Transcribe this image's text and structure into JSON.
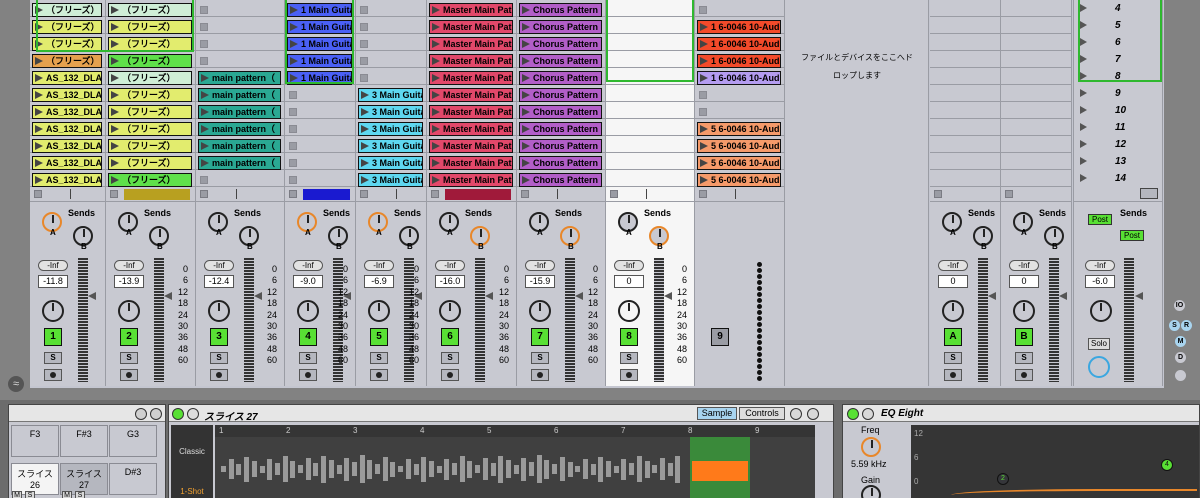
{
  "tracks": [
    {
      "id": "t1",
      "clips": [
        {
          "t": "（フリーズ）",
          "c": "#cfeed6"
        },
        {
          "t": "（フリーズ）",
          "c": "#e2ec6e"
        },
        {
          "t": "（フリーズ）",
          "c": "#e2ec6e"
        },
        {
          "t": "（フリーズ）",
          "c": "#e5a14e"
        },
        {
          "t": "AS_132_DLA",
          "c": "#e2ec6e"
        },
        {
          "t": "AS_132_DLA",
          "c": "#e2ec6e"
        },
        {
          "t": "AS_132_DLA",
          "c": "#e2ec6e"
        },
        {
          "t": "AS_132_DLA",
          "c": "#e2ec6e"
        },
        {
          "t": "AS_132_DLA",
          "c": "#e2ec6e"
        },
        {
          "t": "AS_132_DLA",
          "c": "#e2ec6e"
        },
        {
          "t": "AS_132_DLA",
          "c": "#e2ec6e"
        },
        {
          "t": "AS_132_DLA",
          "c": "#e2ec6e"
        }
      ]
    },
    {
      "id": "t2",
      "clips": [
        {
          "t": "（フリーズ）",
          "c": "#cfeed6"
        },
        {
          "t": "（フリーズ）",
          "c": "#e2ec6e"
        },
        {
          "t": "（フリーズ）",
          "c": "#e2ec6e"
        },
        {
          "t": "（フリーズ）",
          "c": "#5fe04a"
        },
        {
          "t": "（フリーズ）",
          "c": "#cfeed6"
        },
        {
          "t": "（フリーズ）",
          "c": "#e2ec6e"
        },
        {
          "t": "（フリーズ）",
          "c": "#e2ec6e"
        },
        {
          "t": "（フリーズ）",
          "c": "#e2ec6e"
        },
        {
          "t": "（フリーズ）",
          "c": "#e2ec6e"
        },
        {
          "t": "（フリーズ）",
          "c": "#e2ec6e"
        },
        {
          "t": "（フリーズ）",
          "c": "#5fe04a"
        },
        {
          "t": "",
          "c": ""
        }
      ]
    },
    {
      "id": "t3",
      "clips": [
        {
          "t": "",
          "c": ""
        },
        {
          "t": "",
          "c": ""
        },
        {
          "t": "",
          "c": ""
        },
        {
          "t": "",
          "c": ""
        },
        {
          "t": "main pattern（",
          "c": "#2aa893"
        },
        {
          "t": "main pattern（",
          "c": "#2aa893"
        },
        {
          "t": "main pattern（",
          "c": "#2aa893"
        },
        {
          "t": "main pattern（",
          "c": "#2aa893"
        },
        {
          "t": "main pattern（",
          "c": "#2aa893"
        },
        {
          "t": "main pattern（",
          "c": "#2aa893"
        },
        {
          "t": "",
          "c": ""
        },
        {
          "t": "",
          "c": ""
        }
      ]
    },
    {
      "id": "t4",
      "clips": [
        {
          "t": "1 Main Guita",
          "c": "#4a60f5"
        },
        {
          "t": "1 Main Guita",
          "c": "#4a60f5"
        },
        {
          "t": "1 Main Guita",
          "c": "#4a60f5"
        },
        {
          "t": "1 Main Guita",
          "c": "#4a60f5"
        },
        {
          "t": "1 Main Guita",
          "c": "#4a60f5"
        },
        {
          "t": "",
          "c": ""
        },
        {
          "t": "",
          "c": ""
        },
        {
          "t": "",
          "c": ""
        },
        {
          "t": "",
          "c": ""
        },
        {
          "t": "",
          "c": ""
        },
        {
          "t": "",
          "c": ""
        },
        {
          "t": "1 Main Guita",
          "c": "#4a60f5"
        }
      ]
    },
    {
      "id": "t5",
      "clips": [
        {
          "t": "",
          "c": ""
        },
        {
          "t": "",
          "c": ""
        },
        {
          "t": "",
          "c": ""
        },
        {
          "t": "",
          "c": ""
        },
        {
          "t": "",
          "c": ""
        },
        {
          "t": "3 Main Guita",
          "c": "#5ed7f0"
        },
        {
          "t": "3 Main Guita",
          "c": "#5ed7f0"
        },
        {
          "t": "3 Main Guita",
          "c": "#5ed7f0"
        },
        {
          "t": "3 Main Guita",
          "c": "#5ed7f0"
        },
        {
          "t": "3 Main Guita",
          "c": "#5ed7f0"
        },
        {
          "t": "3 Main Guita",
          "c": "#5ed7f0"
        },
        {
          "t": "",
          "c": ""
        }
      ]
    },
    {
      "id": "t6",
      "clips": [
        {
          "t": "Master Main Pat",
          "c": "#e2486a"
        },
        {
          "t": "Master Main Pat",
          "c": "#e2486a"
        },
        {
          "t": "Master Main Pat",
          "c": "#e2486a"
        },
        {
          "t": "Master Main Pat",
          "c": "#e2486a"
        },
        {
          "t": "Master Main Pat",
          "c": "#e2486a"
        },
        {
          "t": "Master Main Pat",
          "c": "#e2486a"
        },
        {
          "t": "Master Main Pat",
          "c": "#e2486a"
        },
        {
          "t": "Master Main Pat",
          "c": "#e2486a"
        },
        {
          "t": "Master Main Pat",
          "c": "#e2486a"
        },
        {
          "t": "Master Main Pat",
          "c": "#e2486a"
        },
        {
          "t": "Master Main Pat",
          "c": "#e2486a"
        },
        {
          "t": "Master Main Pat",
          "c": "#e2486a"
        }
      ]
    },
    {
      "id": "t7",
      "clips": [
        {
          "t": "Chorus Pattern",
          "c": "#b25ec8"
        },
        {
          "t": "Chorus Pattern",
          "c": "#b25ec8"
        },
        {
          "t": "Chorus Pattern",
          "c": "#b25ec8"
        },
        {
          "t": "Chorus Pattern",
          "c": "#b25ec8"
        },
        {
          "t": "Chorus Pattern",
          "c": "#b25ec8"
        },
        {
          "t": "Chorus Pattern",
          "c": "#b25ec8"
        },
        {
          "t": "Chorus Pattern",
          "c": "#b25ec8"
        },
        {
          "t": "Chorus Pattern",
          "c": "#b25ec8"
        },
        {
          "t": "Chorus Pattern",
          "c": "#b25ec8"
        },
        {
          "t": "Chorus Pattern",
          "c": "#b25ec8"
        },
        {
          "t": "Chorus Pattern",
          "c": "#b25ec8"
        },
        {
          "t": "Chorus Pattern",
          "c": "#b25ec8"
        }
      ]
    },
    {
      "id": "t8",
      "clips": []
    },
    {
      "id": "t9",
      "clips": [
        {
          "t": "",
          "c": ""
        },
        {
          "t": "1 6-0046 10-Aud",
          "c": "#f24a2a"
        },
        {
          "t": "1 6-0046 10-Aud",
          "c": "#f24a2a"
        },
        {
          "t": "1 6-0046 10-Aud",
          "c": "#f24a2a"
        },
        {
          "t": "1 6-0046 10-Aud",
          "c": "#b49cf0"
        },
        {
          "t": "",
          "c": ""
        },
        {
          "t": "",
          "c": ""
        },
        {
          "t": "5 6-0046 10-Aud",
          "c": "#f59a6a"
        },
        {
          "t": "5 6-0046 10-Aud",
          "c": "#f59a6a"
        },
        {
          "t": "5 6-0046 10-Aud",
          "c": "#f59a6a"
        },
        {
          "t": "5 6-0046 10-Aud",
          "c": "#f59a6a"
        },
        {
          "t": "5 6-0046 10-Aud",
          "c": "#b49cf0"
        }
      ]
    }
  ],
  "mixer": [
    {
      "vol": "-11.8",
      "num": "1"
    },
    {
      "vol": "-13.9",
      "num": "2"
    },
    {
      "vol": "-12.4",
      "num": "3"
    },
    {
      "vol": "-9.0",
      "num": "4"
    },
    {
      "vol": "-6.9",
      "num": "5"
    },
    {
      "vol": "-16.0",
      "num": "6"
    },
    {
      "vol": "-15.9",
      "num": "7"
    },
    {
      "vol": "0",
      "num": "8"
    },
    {
      "vol": "",
      "num": "9"
    }
  ],
  "returns": [
    {
      "vol": "0",
      "num": "A"
    },
    {
      "vol": "0",
      "num": "B"
    }
  ],
  "master": {
    "vol": "-6.0",
    "post1": "Post",
    "post2": "Post",
    "solo": "Solo"
  },
  "labels": {
    "sends": "Sends",
    "inf": "-Inf",
    "a": "A",
    "b": "B",
    "s": "S"
  },
  "scale": [
    "0",
    "6",
    "12",
    "18",
    "24",
    "30",
    "36",
    "48",
    "60"
  ],
  "drop_text": {
    "line1": "ファイルとデバイスをここへド",
    "line2": "ロップします"
  },
  "scenes": [
    "4",
    "5",
    "6",
    "7",
    "8",
    "9",
    "10",
    "11",
    "12",
    "13",
    "14"
  ],
  "right_buttons": [
    "IO",
    "S",
    "R",
    "M",
    "D"
  ],
  "drum": {
    "pads": [
      {
        "t": "F3"
      },
      {
        "t": "F#3"
      },
      {
        "t": "G3"
      },
      {
        "t": "スライス\n26"
      },
      {
        "t": "スライス\n27"
      },
      {
        "t": "D#3"
      }
    ],
    "m": "M",
    "s": "S"
  },
  "simpler": {
    "title": "スライス 27",
    "tab_sample": "Sample",
    "tab_controls": "Controls",
    "classic": "Classic",
    "oneshot": "1-Shot",
    "markers": [
      "1",
      "2",
      "3",
      "4",
      "5",
      "6",
      "7",
      "8",
      "9"
    ]
  },
  "eq": {
    "title": "EQ Eight",
    "freq_label": "Freq",
    "freq_value": "5.59 kHz",
    "gain_label": "Gain",
    "db": [
      "12",
      "6",
      "0"
    ],
    "bands": [
      "2",
      "4"
    ]
  }
}
